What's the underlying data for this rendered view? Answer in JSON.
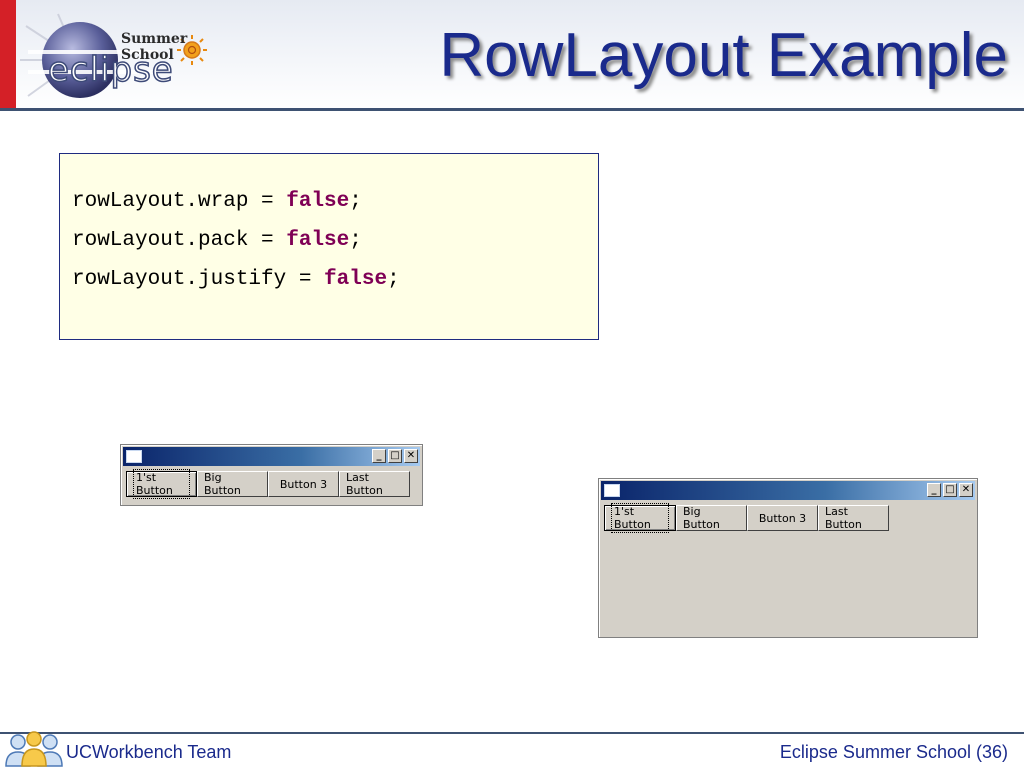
{
  "header": {
    "logo_text": "eclipse",
    "logo_subtitle": "Summer School",
    "title": "RowLayout Example"
  },
  "code": {
    "lines": [
      {
        "prefix": "rowLayout.wrap = ",
        "keyword": "false",
        "suffix": ";"
      },
      {
        "prefix": "rowLayout.pack = ",
        "keyword": "false",
        "suffix": ";"
      },
      {
        "prefix": "rowLayout.justify = ",
        "keyword": "false",
        "suffix": ";"
      }
    ]
  },
  "window_small": {
    "minimize": "_",
    "maximize": "□",
    "close": "✕",
    "buttons": [
      "1'st Button",
      "Big Button",
      "Button 3",
      "Last Button"
    ]
  },
  "window_large": {
    "minimize": "_",
    "maximize": "□",
    "close": "✕",
    "buttons": [
      "1'st Button",
      "Big Button",
      "Button 3",
      "Last Button"
    ]
  },
  "footer": {
    "left": "UCWorkbench Team",
    "right": "Eclipse Summer School (36)"
  },
  "colors": {
    "title": "#1a2a8c",
    "keyword": "#7f0055",
    "accent_red": "#d42027",
    "window_bg": "#d4d0c8"
  },
  "icons": {
    "logo": "eclipse-sphere-icon",
    "sun": "sun-icon",
    "team": "people-group-icon"
  }
}
